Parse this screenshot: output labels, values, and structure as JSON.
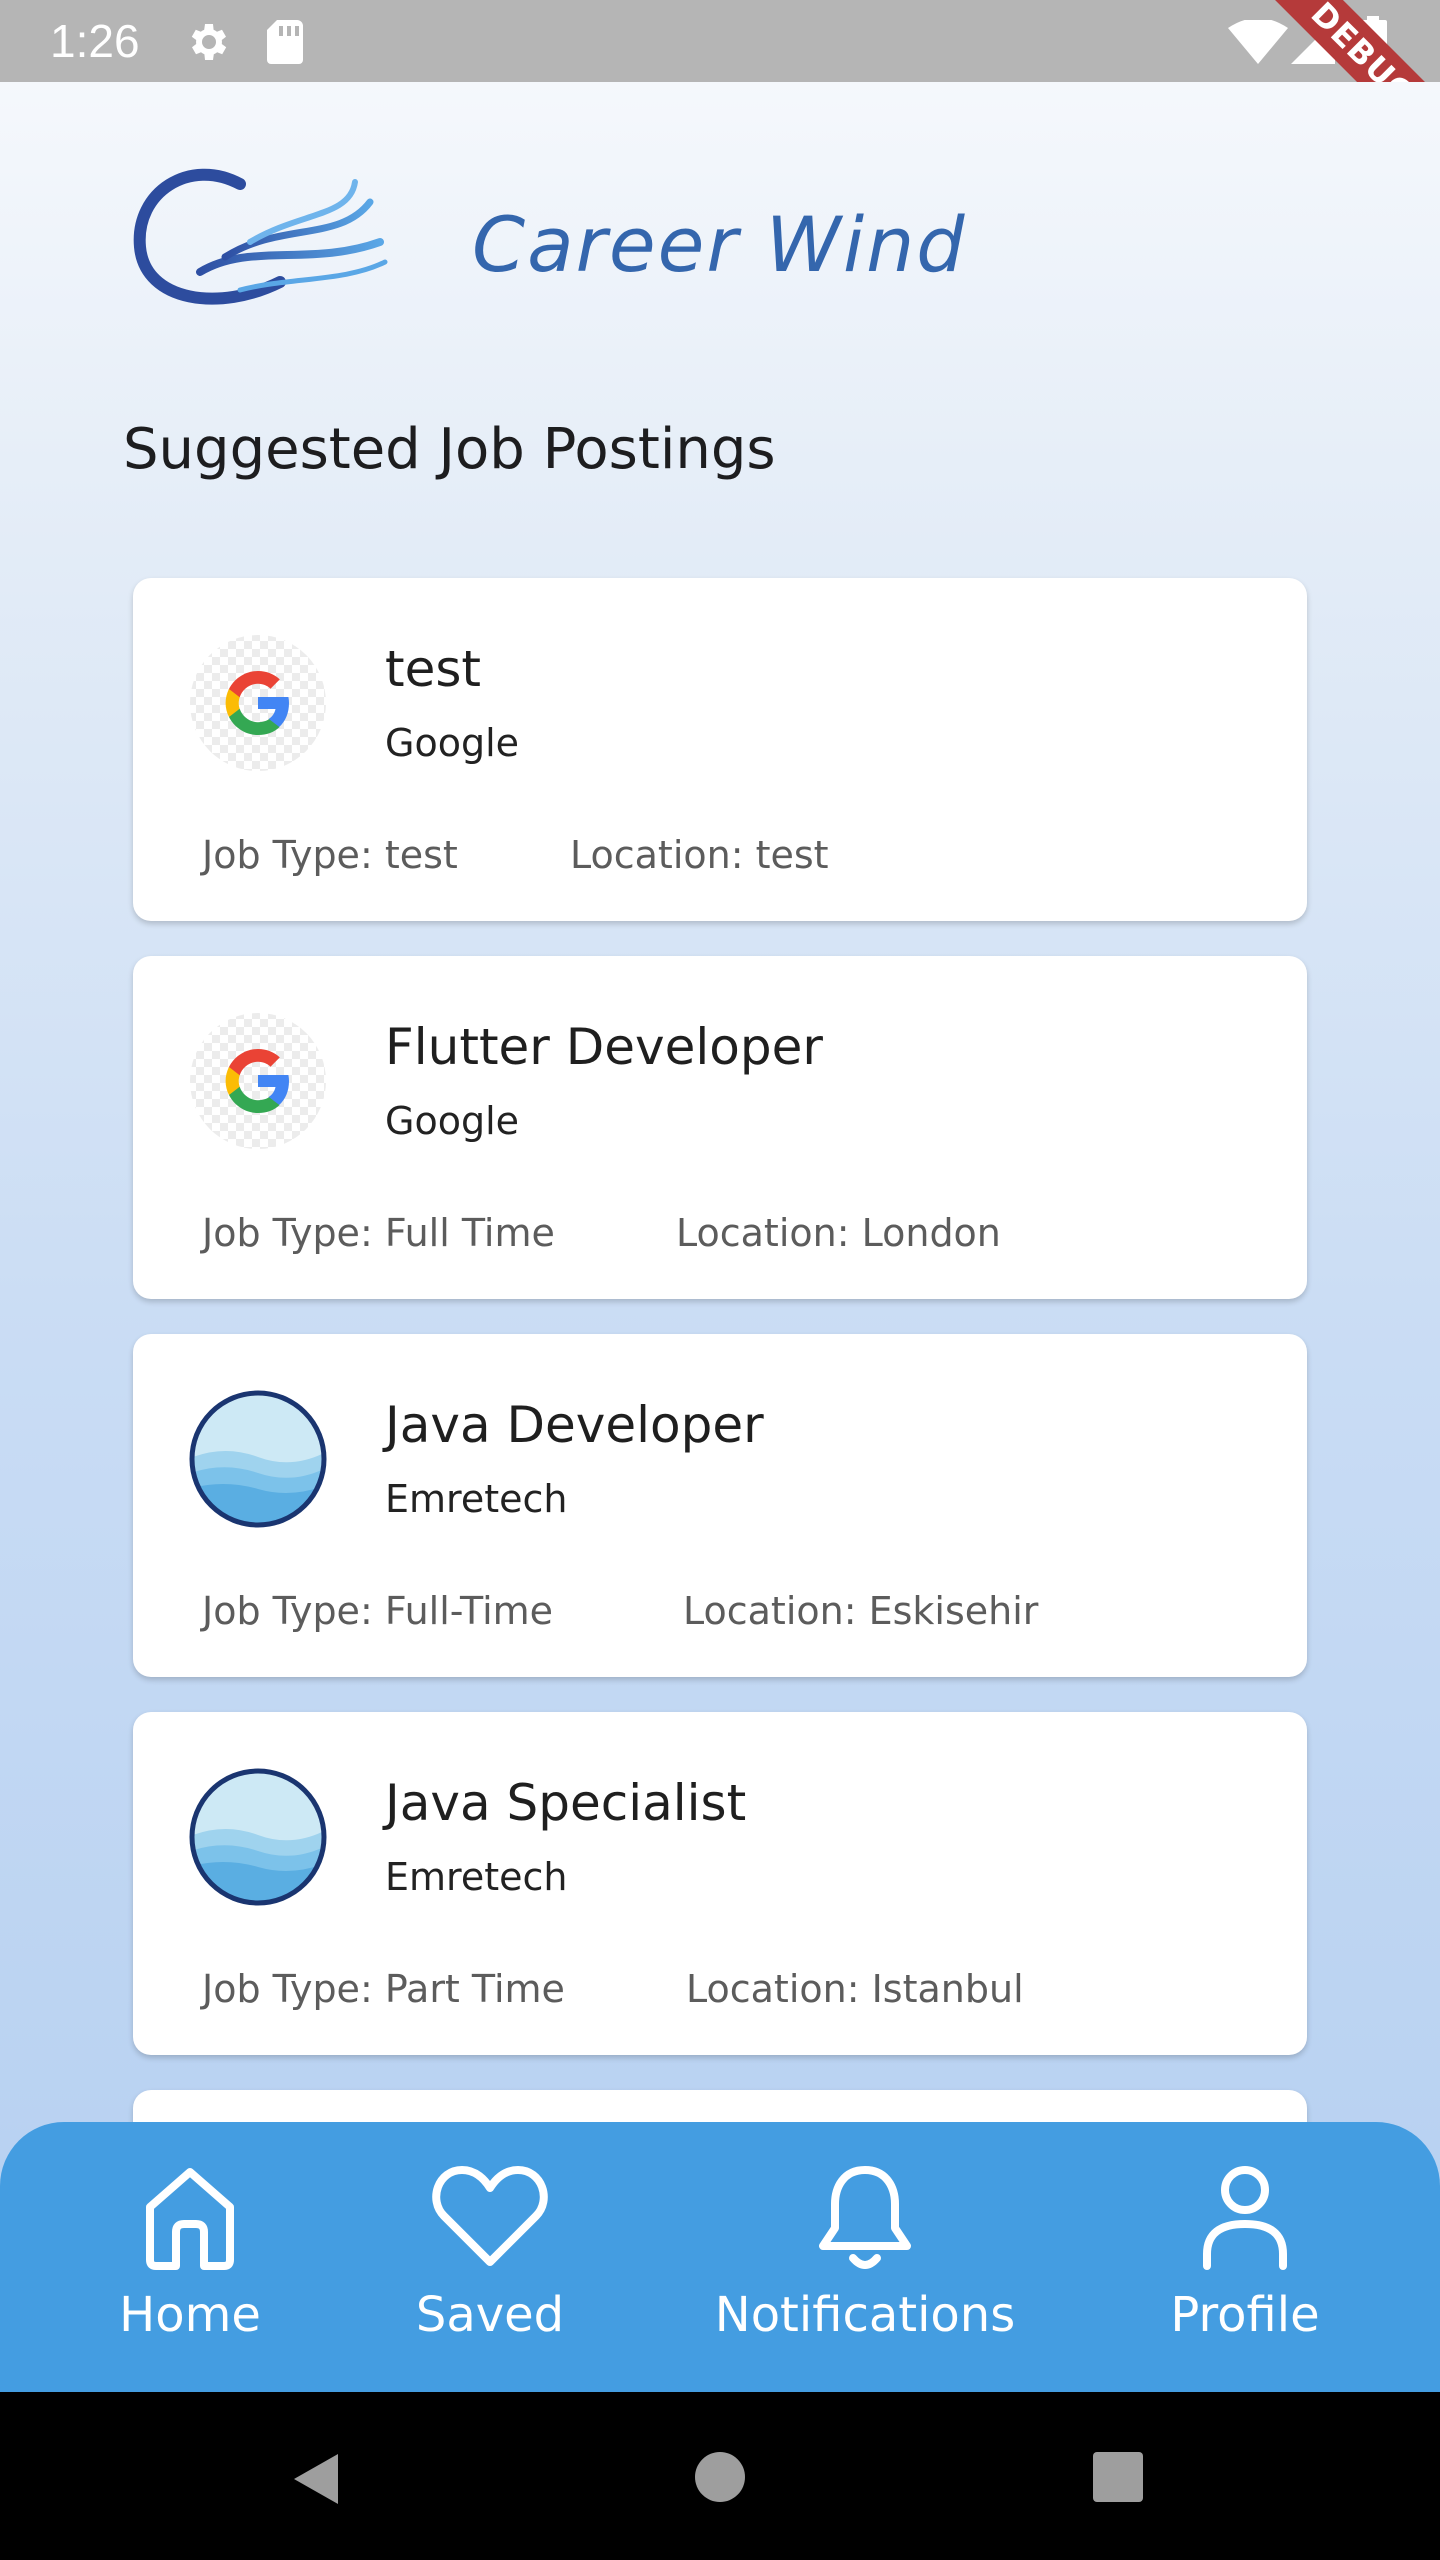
{
  "status_bar": {
    "time": "1:26",
    "debug_label": "DEBUG",
    "icons": [
      "gear-icon",
      "sd-card-icon",
      "wifi-icon",
      "signal-icon",
      "battery-icon"
    ]
  },
  "header": {
    "brand": "Career Wind",
    "logo": "career-wind-logo"
  },
  "section": {
    "title": "Suggested Job Postings"
  },
  "jobs": [
    {
      "title": "test",
      "company": "Google",
      "job_type": "Job Type: test",
      "location": "Location: test",
      "logo": "google-logo"
    },
    {
      "title": "Flutter Developer",
      "company": "Google",
      "job_type": "Job Type: Full Time",
      "location": "Location: London",
      "logo": "google-logo"
    },
    {
      "title": "Java Developer",
      "company": "Emretech",
      "job_type": "Job Type: Full-Time",
      "location": "Location: Eskisehir",
      "logo": "wave-logo"
    },
    {
      "title": "Java Specialist",
      "company": "Emretech",
      "job_type": "Job Type: Part Time",
      "location": "Location: Istanbul",
      "logo": "wave-logo"
    }
  ],
  "bottom_nav": {
    "items": [
      {
        "label": "Home",
        "icon": "home-icon"
      },
      {
        "label": "Saved",
        "icon": "heart-icon"
      },
      {
        "label": "Notifications",
        "icon": "bell-icon"
      },
      {
        "label": "Profile",
        "icon": "profile-icon"
      }
    ]
  },
  "system_nav": {
    "icons": [
      "back-icon",
      "home-circle-icon",
      "recents-icon"
    ]
  },
  "colors": {
    "accent": "#449de1",
    "brand_text": "#3466ad",
    "status_bar": "#b5b5b5"
  }
}
